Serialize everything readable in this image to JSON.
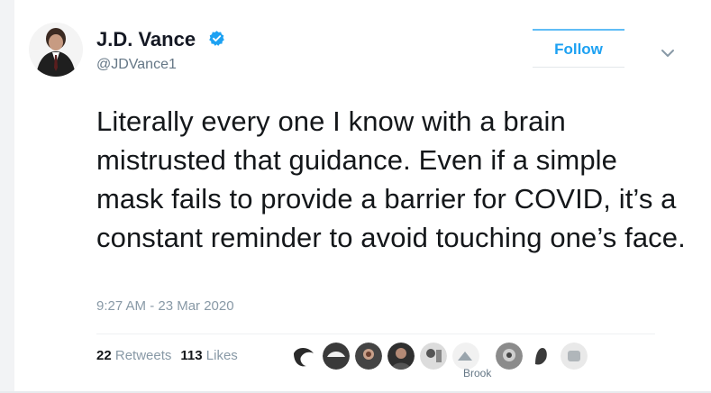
{
  "author": {
    "name": "J.D. Vance",
    "handle": "@JDVance1",
    "verified": true,
    "avatar": "profile-photo"
  },
  "follow_button": {
    "label": "Follow"
  },
  "tweet": {
    "text": "Literally every one I know with a brain mistrusted that guidance. Even if a simple mask fails to provide a barrier for COVID, it’s a constant reminder to avoid touching one’s face.",
    "timestamp": "9:27 AM - 23 Mar 2020"
  },
  "stats": {
    "retweets_count": "22",
    "retweets_label": "Retweets",
    "likes_count": "113",
    "likes_label": "Likes"
  },
  "likers": {
    "visible_label": "Brook",
    "count_shown": 9
  },
  "colors": {
    "accent": "#1da1f2",
    "text": "#14171a",
    "muted": "#8899a6"
  },
  "icons": {
    "verified": "verified-badge-icon",
    "menu": "chevron-down-icon"
  }
}
